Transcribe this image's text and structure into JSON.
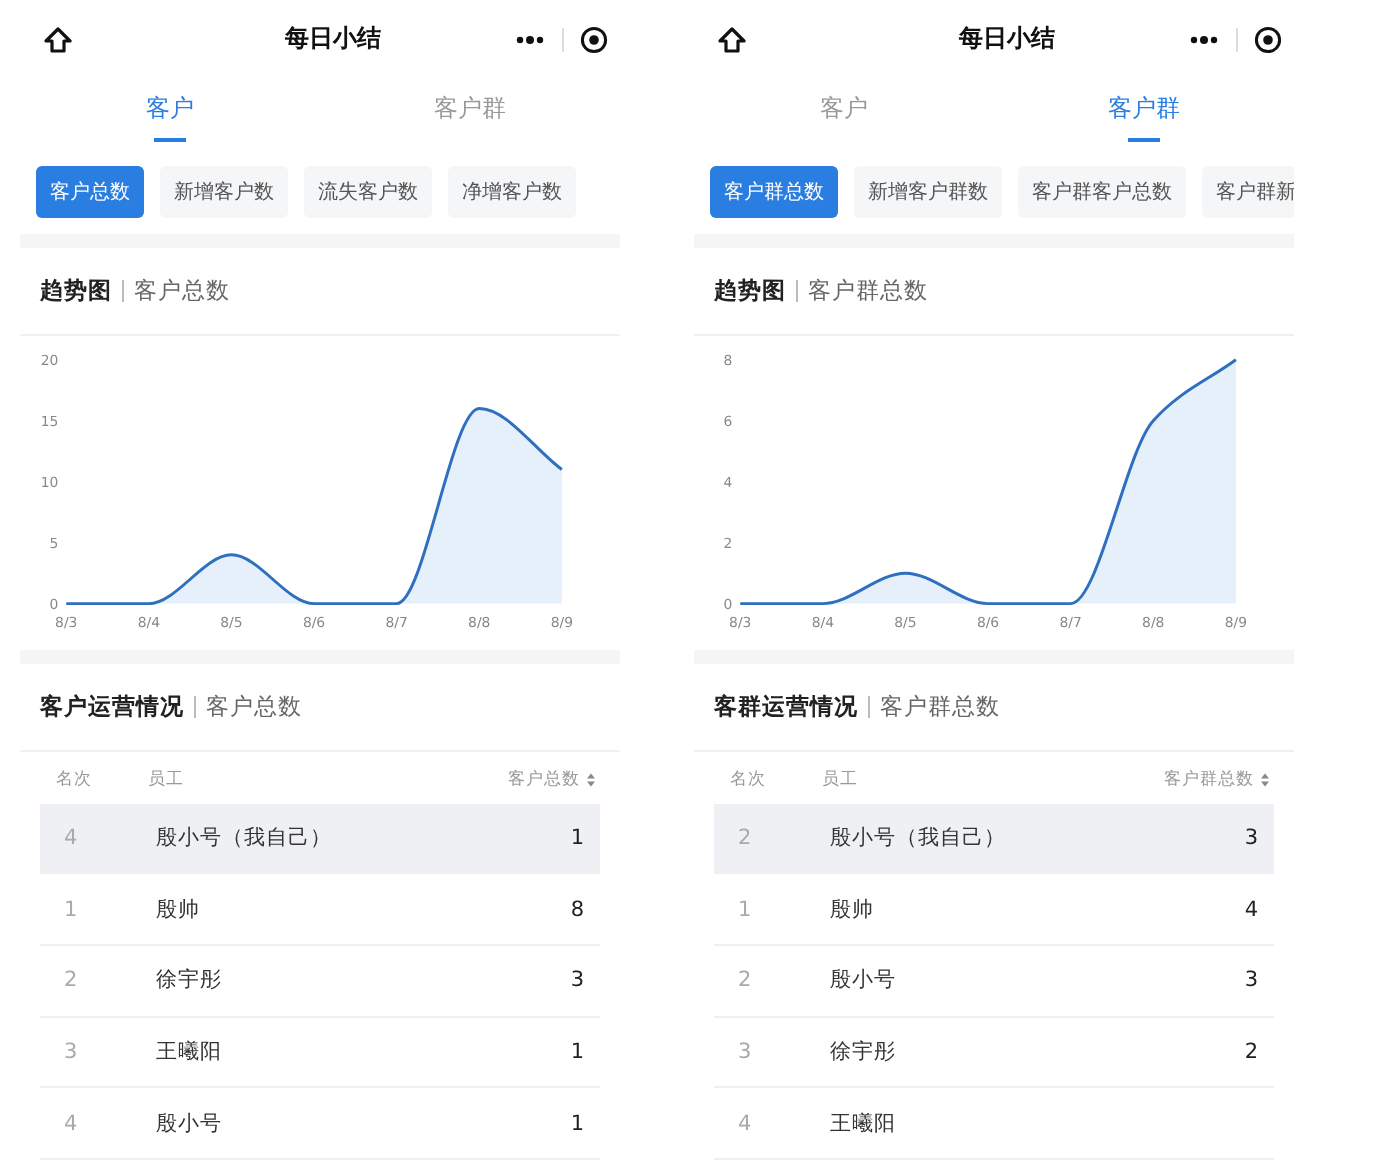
{
  "screens": [
    {
      "title": "每日小结",
      "tabs": [
        {
          "label": "客户",
          "selected": true
        },
        {
          "label": "客户群",
          "selected": false
        }
      ],
      "filters": [
        {
          "label": "客户总数",
          "selected": true
        },
        {
          "label": "新增客户数",
          "selected": false
        },
        {
          "label": "流失客户数",
          "selected": false
        },
        {
          "label": "净增客户数",
          "selected": false
        }
      ],
      "trend": {
        "title": "趋势图",
        "subtitle": "客户总数"
      },
      "chart_data": {
        "type": "area",
        "categories": [
          "8/3",
          "8/4",
          "8/5",
          "8/6",
          "8/7",
          "8/8",
          "8/9"
        ],
        "values": [
          0,
          0,
          4,
          0,
          0,
          16,
          11
        ],
        "ylim": [
          0,
          20
        ],
        "yticks": [
          0,
          5,
          10,
          15,
          20
        ]
      },
      "ops": {
        "title": "客户运营情况",
        "subtitle": "客户总数"
      },
      "table": {
        "columns": [
          "名次",
          "员工",
          "客户总数"
        ],
        "rows": [
          {
            "rank": "4",
            "name": "殷小号（我自己）",
            "value": "1",
            "highlighted": true
          },
          {
            "rank": "1",
            "name": "殷帅",
            "value": "8",
            "highlighted": false
          },
          {
            "rank": "2",
            "name": "徐宇彤",
            "value": "3",
            "highlighted": false
          },
          {
            "rank": "3",
            "name": "王曦阳",
            "value": "1",
            "highlighted": false
          },
          {
            "rank": "4",
            "name": "殷小号",
            "value": "1",
            "highlighted": false
          }
        ]
      }
    },
    {
      "title": "每日小结",
      "tabs": [
        {
          "label": "客户",
          "selected": false
        },
        {
          "label": "客户群",
          "selected": true
        }
      ],
      "filters": [
        {
          "label": "客户群总数",
          "selected": true
        },
        {
          "label": "新增客户群数",
          "selected": false
        },
        {
          "label": "客户群客户总数",
          "selected": false
        },
        {
          "label": "客户群新",
          "selected": false
        }
      ],
      "trend": {
        "title": "趋势图",
        "subtitle": "客户群总数"
      },
      "chart_data": {
        "type": "area",
        "categories": [
          "8/3",
          "8/4",
          "8/5",
          "8/6",
          "8/7",
          "8/8",
          "8/9"
        ],
        "values": [
          0,
          0,
          1,
          0,
          0,
          6,
          8
        ],
        "ylim": [
          0,
          8
        ],
        "yticks": [
          0,
          2,
          4,
          6,
          8
        ]
      },
      "ops": {
        "title": "客群运营情况",
        "subtitle": "客户群总数"
      },
      "table": {
        "columns": [
          "名次",
          "员工",
          "客户群总数"
        ],
        "rows": [
          {
            "rank": "2",
            "name": "殷小号（我自己）",
            "value": "3",
            "highlighted": true
          },
          {
            "rank": "1",
            "name": "殷帅",
            "value": "4",
            "highlighted": false
          },
          {
            "rank": "2",
            "name": "殷小号",
            "value": "3",
            "highlighted": false
          },
          {
            "rank": "3",
            "name": "徐宇彤",
            "value": "2",
            "highlighted": false
          },
          {
            "rank": "4",
            "name": "王曦阳",
            "highlighted": false
          }
        ]
      }
    }
  ]
}
